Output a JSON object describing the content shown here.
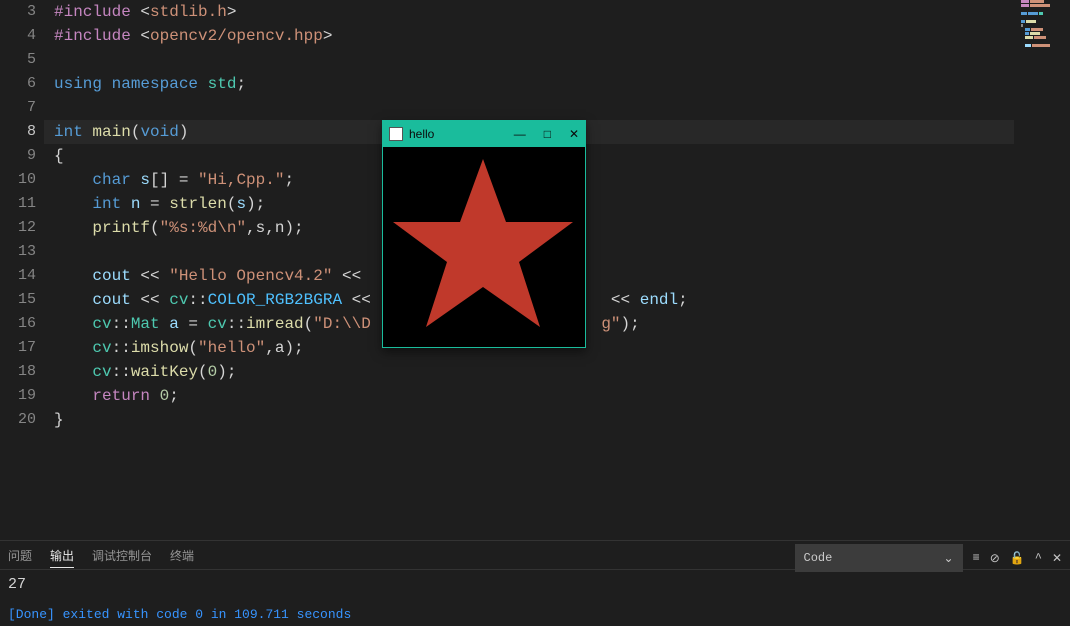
{
  "gutter": [
    "3",
    "4",
    "5",
    "6",
    "7",
    "8",
    "9",
    "10",
    "11",
    "12",
    "13",
    "14",
    "15",
    "16",
    "17",
    "18",
    "19",
    "20"
  ],
  "active_line_index": 5,
  "code": {
    "l3": {
      "include": "#include",
      "open": " <",
      "lib": "stdlib.h",
      "close": ">"
    },
    "l4": {
      "include": "#include",
      "open": " <",
      "lib": "opencv2/opencv.hpp",
      "close": ">"
    },
    "l6": {
      "using": "using",
      "ns": " namespace",
      "std": " std",
      "semi": ";"
    },
    "l8": {
      "int": "int",
      "main": " main",
      "p1": "(",
      "void": "void",
      "p2": ")"
    },
    "l9": {
      "brace": "{"
    },
    "l10": {
      "indent": "    ",
      "char": "char",
      "s": " s",
      "b1": "[] = ",
      "str": "\"Hi,Cpp.\"",
      "semi": ";"
    },
    "l11": {
      "indent": "    ",
      "int": "int",
      "n": " n",
      "eq": " = ",
      "fn": "strlen",
      "p1": "(",
      "arg": "s",
      "p2": ");"
    },
    "l12": {
      "indent": "    ",
      "fn": "printf",
      "p1": "(",
      "str": "\"%s:%d\\n\"",
      "rest": ",s,n);"
    },
    "l14": {
      "indent": "    ",
      "cout": "cout",
      "op": " << ",
      "str": "\"Hello Opencv4.2\"",
      "tail": " <<"
    },
    "l15": {
      "indent": "    ",
      "cout": "cout",
      "op": " << ",
      "ns": "cv",
      "cc": "::",
      "cns": "COLOR_RGB2BGRA",
      "mid": " <<",
      "tail1": "<< ",
      "endl": "endl",
      "semi": ";"
    },
    "l16": {
      "indent": "    ",
      "ns1": "cv",
      "cc1": "::",
      "mat": "Mat",
      "a": " a",
      "eq": " = ",
      "ns2": "cv",
      "cc2": "::",
      "fn": "imread",
      "p1": "(",
      "str": "\"D:\\\\D",
      "tail": "g\"",
      "p2": ");"
    },
    "l17": {
      "indent": "    ",
      "ns": "cv",
      "cc": "::",
      "fn": "imshow",
      "p1": "(",
      "str": "\"hello\"",
      "rest": ",a);"
    },
    "l18": {
      "indent": "    ",
      "ns": "cv",
      "cc": "::",
      "fn": "waitKey",
      "p1": "(",
      "num": "0",
      "p2": ");"
    },
    "l19": {
      "indent": "    ",
      "ret": "return",
      "sp": " ",
      "num": "0",
      "semi": ";"
    },
    "l20": {
      "brace": "}"
    }
  },
  "panel": {
    "tabs": {
      "problems": "问题",
      "output": "输出",
      "debug": "调试控制台",
      "terminal": "终端"
    },
    "select_value": "Code",
    "output_count": "27",
    "done_line": "[Done] exited with code 0 in 109.711 seconds"
  },
  "popup": {
    "title": "hello",
    "minimize": "—",
    "maximize": "□",
    "close": "✕"
  }
}
